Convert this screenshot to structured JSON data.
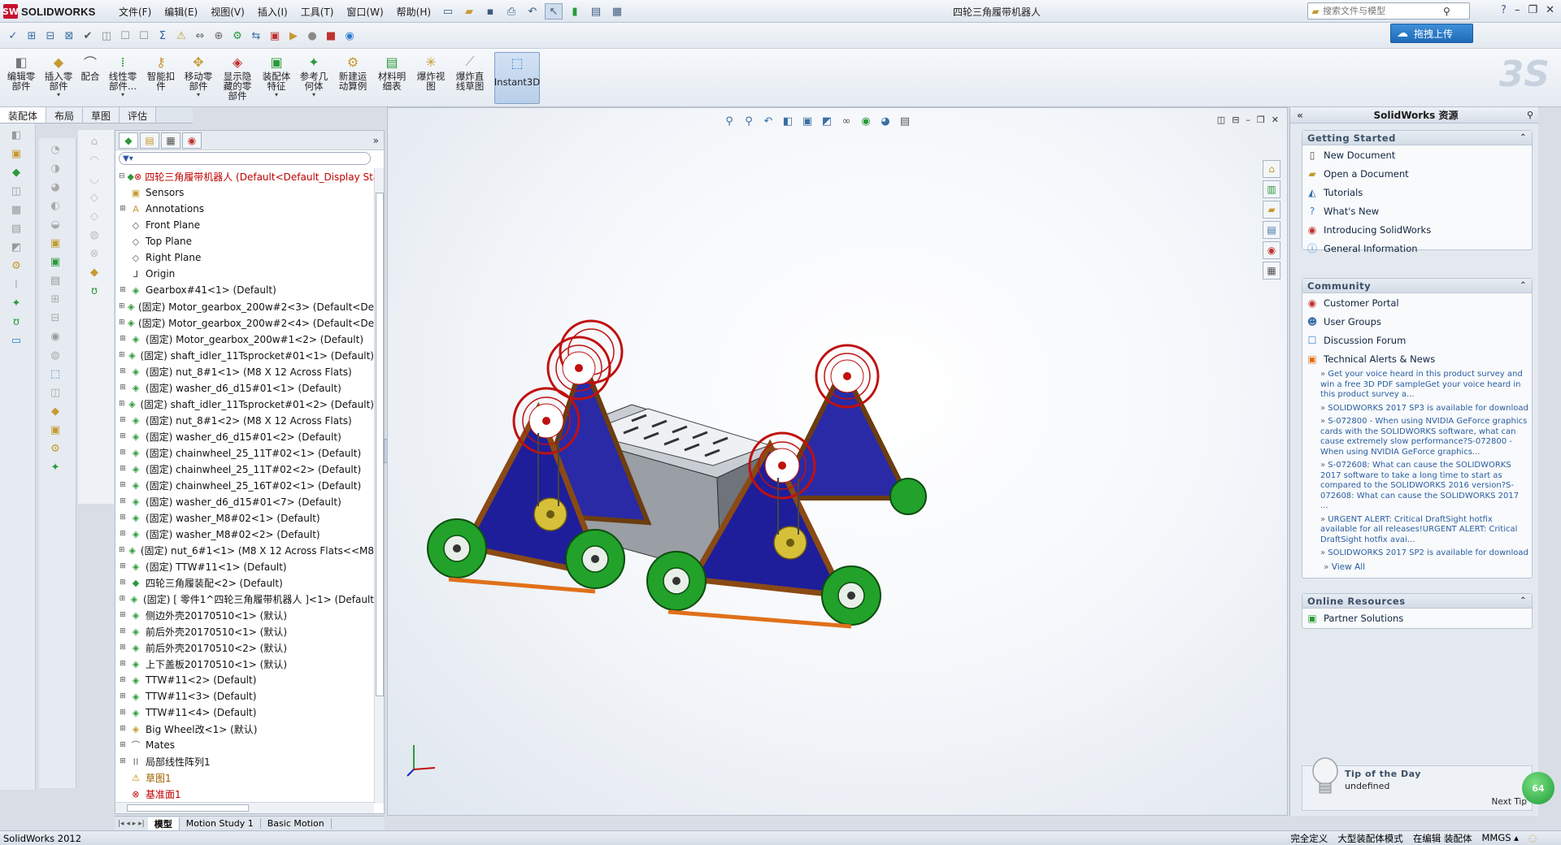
{
  "app": {
    "brand": "SOLIDWORKS",
    "document_title": "四轮三角履带机器人"
  },
  "menu": [
    "文件(F)",
    "编辑(E)",
    "视图(V)",
    "插入(I)",
    "工具(T)",
    "窗口(W)",
    "帮助(H)"
  ],
  "search": {
    "placeholder": "搜索文件与模型"
  },
  "cloud_button": {
    "label": "拖拽上传"
  },
  "command_manager": [
    {
      "label": "编辑零\n部件",
      "icon": "edit-component-icon"
    },
    {
      "label": "插入零\n部件",
      "icon": "insert-component-icon"
    },
    {
      "label": "配合",
      "icon": "mate-icon"
    },
    {
      "label": "线性零\n部件...",
      "icon": "linear-pattern-icon"
    },
    {
      "label": "智能扣\n件",
      "icon": "smart-fastener-icon"
    },
    {
      "label": "移动零\n部件",
      "icon": "move-component-icon"
    },
    {
      "label": "显示隐\n藏的零\n部件",
      "icon": "show-hidden-icon"
    },
    {
      "label": "装配体\n特征",
      "icon": "assembly-feature-icon"
    },
    {
      "label": "参考几\n何体",
      "icon": "reference-geometry-icon"
    },
    {
      "label": "新建运\n动算例",
      "icon": "motion-study-icon"
    },
    {
      "label": "材料明\n细表",
      "icon": "bom-icon"
    },
    {
      "label": "爆炸视\n图",
      "icon": "explode-view-icon"
    },
    {
      "label": "爆炸直\n线草图",
      "icon": "explode-line-icon"
    },
    {
      "label": "Instant3D",
      "icon": "instant3d-icon"
    }
  ],
  "cm_tabs": [
    "装配体",
    "布局",
    "草图",
    "评估"
  ],
  "tree": {
    "root": "四轮三角履带机器人  (Default<Default_Display Sta",
    "items": [
      {
        "label": "Sensors",
        "icon": "folder",
        "exp": false
      },
      {
        "label": "Annotations",
        "icon": "annotation",
        "exp": true
      },
      {
        "label": "Front Plane",
        "icon": "plane",
        "exp": false
      },
      {
        "label": "Top Plane",
        "icon": "plane",
        "exp": false
      },
      {
        "label": "Right Plane",
        "icon": "plane",
        "exp": false
      },
      {
        "label": "Origin",
        "icon": "origin",
        "exp": false
      },
      {
        "label": "Gearbox#41<1> (Default)",
        "icon": "part",
        "exp": true
      },
      {
        "label": "(固定) Motor_gearbox_200w#2<3> (Default<De",
        "icon": "part",
        "exp": true
      },
      {
        "label": "(固定) Motor_gearbox_200w#2<4> (Default<De",
        "icon": "part",
        "exp": true
      },
      {
        "label": "(固定) Motor_gearbox_200w#1<2> (Default)",
        "icon": "part",
        "exp": true
      },
      {
        "label": "(固定) shaft_idler_11Tsprocket#01<1> (Default)",
        "icon": "part",
        "exp": true
      },
      {
        "label": "(固定) nut_8#1<1> (M8 X 12 Across Flats)",
        "icon": "part",
        "exp": true
      },
      {
        "label": "(固定) washer_d6_d15#01<1> (Default)",
        "icon": "part",
        "exp": true
      },
      {
        "label": "(固定) shaft_idler_11Tsprocket#01<2> (Default)",
        "icon": "part",
        "exp": true
      },
      {
        "label": "(固定) nut_8#1<2> (M8 X 12 Across Flats)",
        "icon": "part",
        "exp": true
      },
      {
        "label": "(固定) washer_d6_d15#01<2> (Default)",
        "icon": "part",
        "exp": true
      },
      {
        "label": "(固定) chainwheel_25_11T#02<1> (Default)",
        "icon": "part",
        "exp": true
      },
      {
        "label": "(固定) chainwheel_25_11T#02<2> (Default)",
        "icon": "part",
        "exp": true
      },
      {
        "label": "(固定) chainwheel_25_16T#02<1> (Default)",
        "icon": "part",
        "exp": true
      },
      {
        "label": "(固定) washer_d6_d15#01<7> (Default)",
        "icon": "part",
        "exp": true
      },
      {
        "label": "(固定) washer_M8#02<1> (Default)",
        "icon": "part",
        "exp": true
      },
      {
        "label": "(固定) washer_M8#02<2> (Default)",
        "icon": "part",
        "exp": true
      },
      {
        "label": "(固定) nut_6#1<1> (M8 X 12 Across Flats<<M8",
        "icon": "part",
        "exp": true
      },
      {
        "label": "(固定) TTW#11<1> (Default)",
        "icon": "part",
        "exp": true
      },
      {
        "label": "四轮三角履装配<2> (Default)",
        "icon": "asm",
        "exp": true
      },
      {
        "label": "(固定) [ 零件1^四轮三角履带机器人 ]<1> (Default",
        "icon": "part",
        "exp": true
      },
      {
        "label": "侧边外壳20170510<1> (默认)",
        "icon": "part",
        "exp": true
      },
      {
        "label": "前后外壳20170510<1> (默认)",
        "icon": "part",
        "exp": true
      },
      {
        "label": "前后外壳20170510<2> (默认)",
        "icon": "part",
        "exp": true
      },
      {
        "label": "上下盖板20170510<1> (默认)",
        "icon": "part",
        "exp": true
      },
      {
        "label": "TTW#11<2> (Default)",
        "icon": "part",
        "exp": true
      },
      {
        "label": "TTW#11<3> (Default)",
        "icon": "part",
        "exp": true
      },
      {
        "label": "TTW#11<4> (Default)",
        "icon": "part",
        "exp": true
      },
      {
        "label": "Big Wheel改<1> (默认)",
        "icon": "part-yellow",
        "exp": true
      },
      {
        "label": "Mates",
        "icon": "mates",
        "exp": true
      },
      {
        "label": "局部线性阵列1",
        "icon": "pattern",
        "exp": true
      },
      {
        "label": "草图1",
        "icon": "warn",
        "exp": false,
        "state": "warn"
      },
      {
        "label": "基准面1",
        "icon": "error",
        "exp": false,
        "state": "err"
      }
    ]
  },
  "bottom_tabs": [
    "模型",
    "Motion Study 1",
    "Basic Motion"
  ],
  "taskpane": {
    "title": "SolidWorks 资源",
    "getting_started": {
      "header": "Getting Started",
      "items": [
        "New Document",
        "Open a Document",
        "Tutorials",
        "What's New",
        "Introducing SolidWorks",
        "General Information"
      ]
    },
    "community": {
      "header": "Community",
      "items": [
        "Customer Portal",
        "User Groups",
        "Discussion Forum",
        "Technical Alerts & News"
      ],
      "news": [
        "Get your voice heard in this product survey and win a free 3D PDF sampleGet your voice heard in this product survey a...",
        "SOLIDWORKS 2017 SP3 is available for download",
        "S-072800 - When using NVIDIA GeForce graphics cards with the SOLIDWORKS software, what can cause extremely slow performance?S-072800 - When using NVIDIA GeForce graphics...",
        "S-072608: What can cause the SOLIDWORKS 2017 software to take a long time to start as compared to the SOLIDWORKS 2016 version?S-072608: What can cause the SOLIDWORKS 2017 ...",
        "URGENT ALERT: Critical DraftSight hotfix available for all releases!URGENT ALERT: Critical DraftSight hotfix avai...",
        "SOLIDWORKS 2017 SP2 is available for download"
      ],
      "view_all": "View All"
    },
    "online": {
      "header": "Online Resources",
      "items": [
        "Partner Solutions"
      ]
    },
    "tip": {
      "header": "Tip of the Day",
      "body": "undefined",
      "next": "Next Tip"
    },
    "badge": "64"
  },
  "status": {
    "left": "SolidWorks 2012",
    "right": [
      "完全定义",
      "大型装配体模式",
      "在编辑 装配体",
      "MMGS ▴"
    ]
  }
}
